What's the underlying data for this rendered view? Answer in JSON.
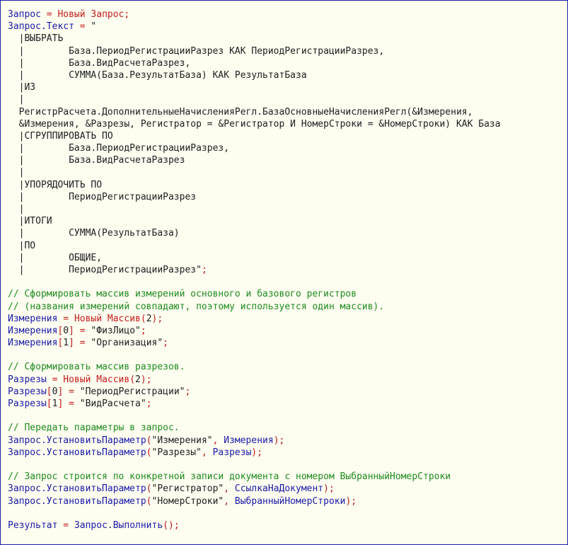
{
  "editor": {
    "lines": [
      [
        {
          "t": "Запрос",
          "c": "id"
        },
        {
          "t": " = ",
          "c": "pn"
        },
        {
          "t": "Новый",
          "c": "kw"
        },
        {
          "t": " ",
          "c": "str"
        },
        {
          "t": "Запрос",
          "c": "kw"
        },
        {
          "t": ";",
          "c": "pn"
        }
      ],
      [
        {
          "t": "Запрос.Текст",
          "c": "id"
        },
        {
          "t": " = ",
          "c": "pn"
        },
        {
          "t": "\"",
          "c": "str"
        }
      ],
      [
        {
          "t": "  |ВЫБРАТЬ",
          "c": "str"
        }
      ],
      [
        {
          "t": "  |        База.ПериодРегистрацииРазрез КАК ПериодРегистрацииРазрез,",
          "c": "str"
        }
      ],
      [
        {
          "t": "  |        База.ВидРасчетаРазрез,",
          "c": "str"
        }
      ],
      [
        {
          "t": "  |        СУММА(База.РезультатБаза) КАК РезультатБаза",
          "c": "str"
        }
      ],
      [
        {
          "t": "  |ИЗ",
          "c": "str"
        }
      ],
      [
        {
          "t": "  |",
          "c": "str"
        }
      ],
      [
        {
          "t": "  РегистрРасчета.ДополнительныеНачисленияРегл.БазаОсновныеНачисленияРегл(&Измерения,",
          "c": "str"
        }
      ],
      [
        {
          "t": "  &Измерения, &Разрезы, Регистратор = &Регистратор И НомерСтроки = &НомерСтроки) КАК База",
          "c": "str"
        }
      ],
      [
        {
          "t": "  |СГРУППИРОВАТЬ ПО",
          "c": "str"
        }
      ],
      [
        {
          "t": "  |        База.ПериодРегистрацииРазрез,",
          "c": "str"
        }
      ],
      [
        {
          "t": "  |        База.ВидРасчетаРазрез",
          "c": "str"
        }
      ],
      [
        {
          "t": "  |",
          "c": "str"
        }
      ],
      [
        {
          "t": "  |УПОРЯДОЧИТЬ ПО",
          "c": "str"
        }
      ],
      [
        {
          "t": "  |        ПериодРегистрацииРазрез",
          "c": "str"
        }
      ],
      [
        {
          "t": "  |",
          "c": "str"
        }
      ],
      [
        {
          "t": "  |ИТОГИ",
          "c": "str"
        }
      ],
      [
        {
          "t": "  |        СУММА(РезультатБаза)",
          "c": "str"
        }
      ],
      [
        {
          "t": "  |ПО",
          "c": "str"
        }
      ],
      [
        {
          "t": "  |        ОБЩИЕ,",
          "c": "str"
        }
      ],
      [
        {
          "t": "  |        ПериодРегистрацииРазрез\"",
          "c": "str"
        },
        {
          "t": ";",
          "c": "pn"
        }
      ],
      [],
      [
        {
          "t": "// Сформировать массив измерений основного и базового регистров",
          "c": "cm"
        }
      ],
      [
        {
          "t": "// (названия измерений совпадают, поэтому используется один массив).",
          "c": "cm"
        }
      ],
      [
        {
          "t": "Измерения",
          "c": "id"
        },
        {
          "t": " = ",
          "c": "pn"
        },
        {
          "t": "Новый",
          "c": "kw"
        },
        {
          "t": " ",
          "c": "str"
        },
        {
          "t": "Массив",
          "c": "kw"
        },
        {
          "t": "(",
          "c": "pn"
        },
        {
          "t": "2",
          "c": "str"
        },
        {
          "t": ");",
          "c": "pn"
        }
      ],
      [
        {
          "t": "Измерения",
          "c": "id"
        },
        {
          "t": "[",
          "c": "pn"
        },
        {
          "t": "0",
          "c": "str"
        },
        {
          "t": "]",
          "c": "pn"
        },
        {
          "t": " = ",
          "c": "pn"
        },
        {
          "t": "\"ФизЛицо\"",
          "c": "str"
        },
        {
          "t": ";",
          "c": "pn"
        }
      ],
      [
        {
          "t": "Измерения",
          "c": "id"
        },
        {
          "t": "[",
          "c": "pn"
        },
        {
          "t": "1",
          "c": "str"
        },
        {
          "t": "]",
          "c": "pn"
        },
        {
          "t": " = ",
          "c": "pn"
        },
        {
          "t": "\"Организация\"",
          "c": "str"
        },
        {
          "t": ";",
          "c": "pn"
        }
      ],
      [],
      [
        {
          "t": "// Сформировать массив разрезов.",
          "c": "cm"
        }
      ],
      [
        {
          "t": "Разрезы",
          "c": "id"
        },
        {
          "t": " = ",
          "c": "pn"
        },
        {
          "t": "Новый",
          "c": "kw"
        },
        {
          "t": " ",
          "c": "str"
        },
        {
          "t": "Массив",
          "c": "kw"
        },
        {
          "t": "(",
          "c": "pn"
        },
        {
          "t": "2",
          "c": "str"
        },
        {
          "t": ");",
          "c": "pn"
        }
      ],
      [
        {
          "t": "Разрезы",
          "c": "id"
        },
        {
          "t": "[",
          "c": "pn"
        },
        {
          "t": "0",
          "c": "str"
        },
        {
          "t": "]",
          "c": "pn"
        },
        {
          "t": " = ",
          "c": "pn"
        },
        {
          "t": "\"ПериодРегистрации\"",
          "c": "str"
        },
        {
          "t": ";",
          "c": "pn"
        }
      ],
      [
        {
          "t": "Разрезы",
          "c": "id"
        },
        {
          "t": "[",
          "c": "pn"
        },
        {
          "t": "1",
          "c": "str"
        },
        {
          "t": "]",
          "c": "pn"
        },
        {
          "t": " = ",
          "c": "pn"
        },
        {
          "t": "\"ВидРасчета\"",
          "c": "str"
        },
        {
          "t": ";",
          "c": "pn"
        }
      ],
      [],
      [
        {
          "t": "// Передать параметры в запрос.",
          "c": "cm"
        }
      ],
      [
        {
          "t": "Запрос.УстановитьПараметр",
          "c": "id"
        },
        {
          "t": "(",
          "c": "pn"
        },
        {
          "t": "\"Измерения\"",
          "c": "str"
        },
        {
          "t": ", ",
          "c": "pn"
        },
        {
          "t": "Измерения",
          "c": "id"
        },
        {
          "t": ");",
          "c": "pn"
        }
      ],
      [
        {
          "t": "Запрос.УстановитьПараметр",
          "c": "id"
        },
        {
          "t": "(",
          "c": "pn"
        },
        {
          "t": "\"Разрезы\"",
          "c": "str"
        },
        {
          "t": ", ",
          "c": "pn"
        },
        {
          "t": "Разрезы",
          "c": "id"
        },
        {
          "t": ");",
          "c": "pn"
        }
      ],
      [],
      [
        {
          "t": "// Запрос строится по конкретной записи документа с номером ВыбранныйНомерСтроки",
          "c": "cm"
        }
      ],
      [
        {
          "t": "Запрос.УстановитьПараметр",
          "c": "id"
        },
        {
          "t": "(",
          "c": "pn"
        },
        {
          "t": "\"Регистратор\"",
          "c": "str"
        },
        {
          "t": ", ",
          "c": "pn"
        },
        {
          "t": "СсылкаНаДокумент",
          "c": "id"
        },
        {
          "t": ");",
          "c": "pn"
        }
      ],
      [
        {
          "t": "Запрос.УстановитьПараметр",
          "c": "id"
        },
        {
          "t": "(",
          "c": "pn"
        },
        {
          "t": "\"НомерСтроки\"",
          "c": "str"
        },
        {
          "t": ", ",
          "c": "pn"
        },
        {
          "t": "ВыбранныйНомерСтроки",
          "c": "id"
        },
        {
          "t": ");",
          "c": "pn"
        }
      ],
      [],
      [
        {
          "t": "Результат",
          "c": "id"
        },
        {
          "t": " = ",
          "c": "pn"
        },
        {
          "t": "Запрос.Выполнить",
          "c": "id"
        },
        {
          "t": "();",
          "c": "pn"
        }
      ]
    ]
  }
}
